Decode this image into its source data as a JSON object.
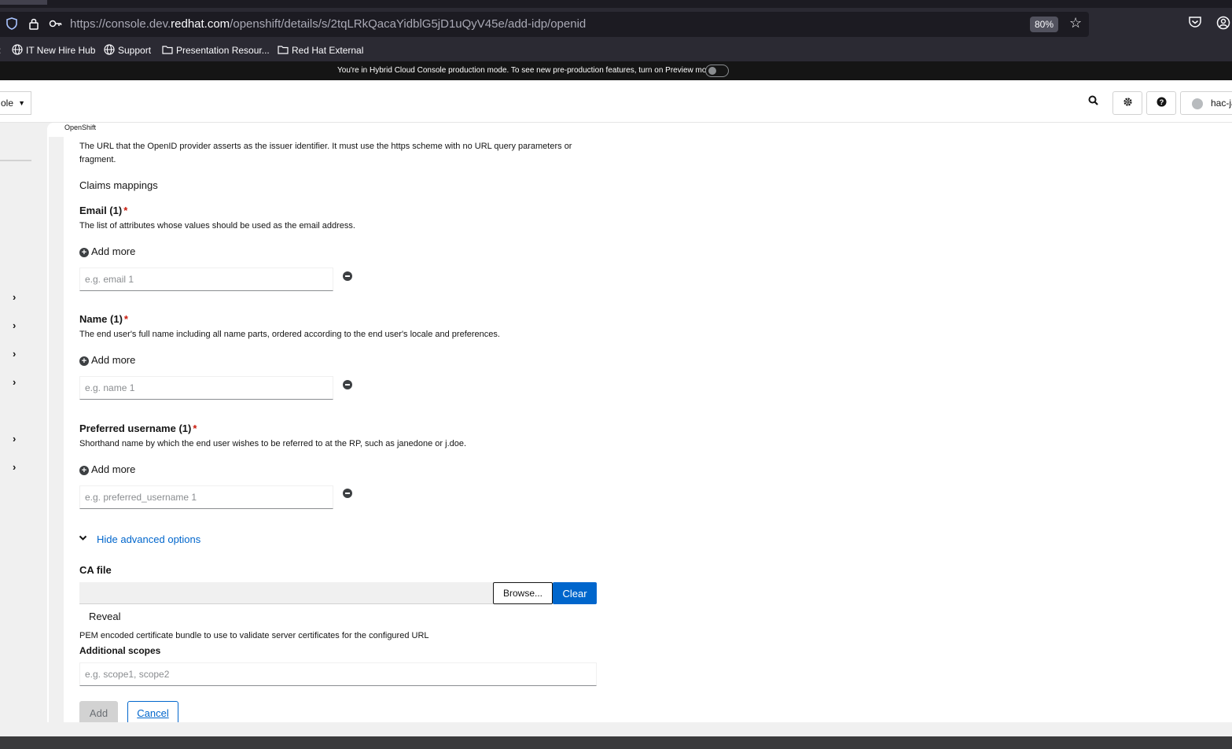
{
  "browser": {
    "url_prefix": "https://console.dev.",
    "url_domain": "redhat.com",
    "url_path": "/openshift/details/s/2tqLRkQacaYidblG5jD1uQyV45e/add-idp/openid",
    "zoom": "80%"
  },
  "bookmarks": [
    {
      "label": "IT New Hire Hub",
      "icon": "globe-icon"
    },
    {
      "label": "Support",
      "icon": "globe-icon"
    },
    {
      "label": "Presentation Resour...",
      "icon": "folder-icon"
    },
    {
      "label": "Red Hat External",
      "icon": "folder-icon"
    }
  ],
  "banner": {
    "text": "You're in Hybrid Cloud Console production mode. To see new pre-production features, turn on Preview mode",
    "preview_on": false
  },
  "masthead": {
    "context_label": "ole",
    "user_name": "hac-ja"
  },
  "breadcrumb": "OpenShift",
  "form": {
    "issuer_help": "The URL that the OpenID provider asserts as the issuer identifier. It must use the https scheme with no URL query parameters or fragment.",
    "claims_heading": "Claims mappings",
    "email": {
      "label": "Email (1)",
      "help": "The list of attributes whose values should be used as the email address.",
      "add_more": "Add more",
      "placeholder": "e.g. email 1"
    },
    "name": {
      "label": "Name (1)",
      "help": "The end user's full name including all name parts, ordered according to the end user's locale and preferences.",
      "add_more": "Add more",
      "placeholder": "e.g. name 1"
    },
    "preferred_username": {
      "label": "Preferred username (1)",
      "help": "Shorthand name by which the end user wishes to be referred to at the RP, such as janedone or j.doe.",
      "add_more": "Add more",
      "placeholder": "e.g. preferred_username 1"
    },
    "advanced_toggle": "Hide advanced options",
    "ca_file": {
      "label": "CA file",
      "browse": "Browse...",
      "clear": "Clear",
      "reveal": "Reveal",
      "help": "PEM encoded certificate bundle to use to validate server certificates for the configured URL"
    },
    "scopes": {
      "label": "Additional scopes",
      "placeholder": "e.g. scope1, scope2"
    },
    "add_button": "Add",
    "cancel_button": "Cancel"
  },
  "colors": {
    "link": "#0066cc",
    "required": "#c9190b",
    "primary_button": "#0066cc"
  }
}
